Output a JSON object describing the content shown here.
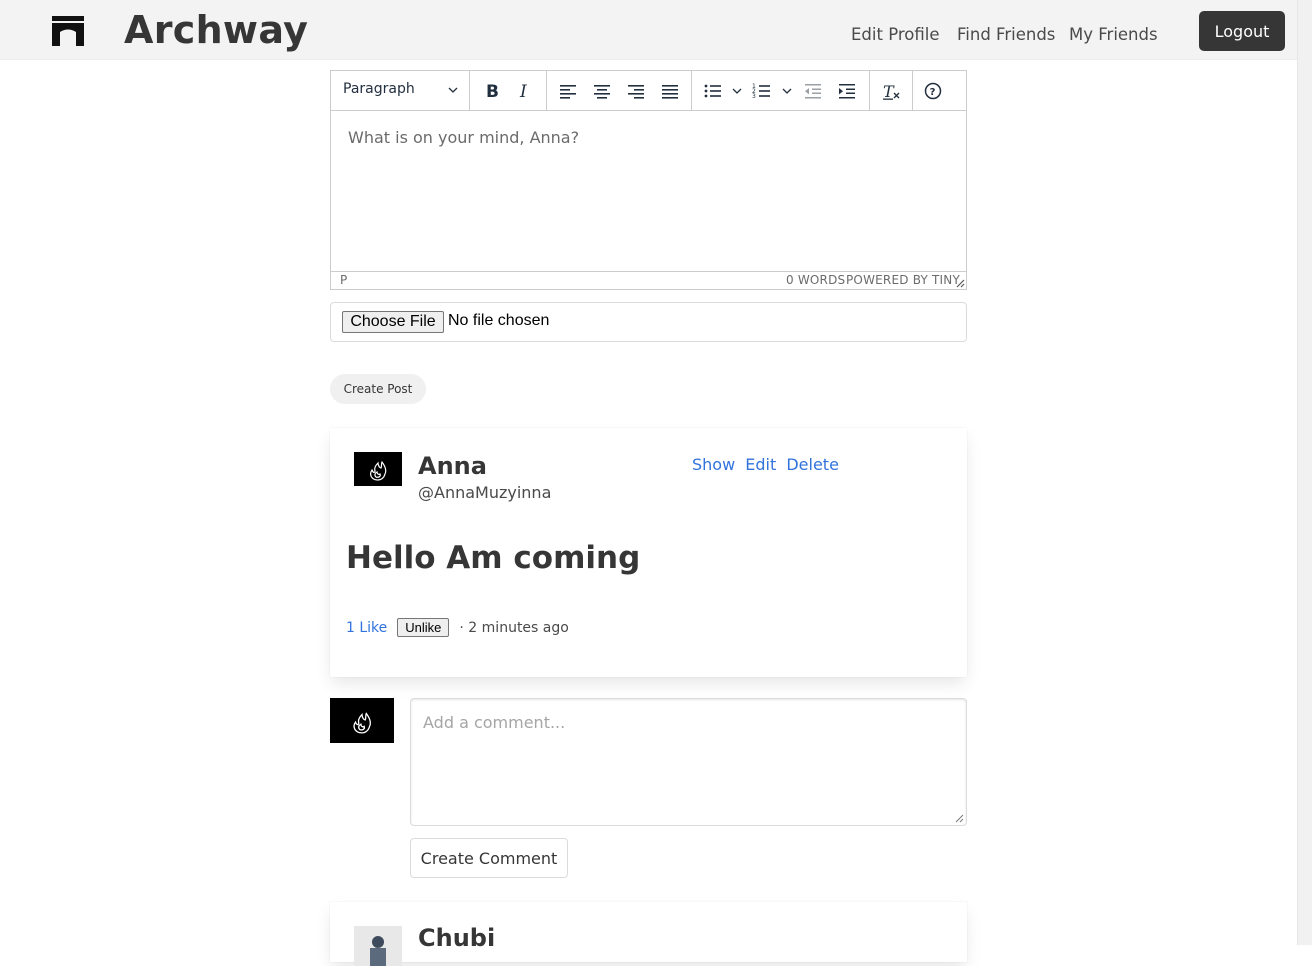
{
  "navbar": {
    "brand": "Archway",
    "links": [
      "Edit Profile",
      "Find Friends",
      "My Friends"
    ],
    "logout": "Logout"
  },
  "editor": {
    "format": "Paragraph",
    "placeholder": "What is on your mind, Anna?",
    "status_path": "P",
    "word_count": "0 WORDS",
    "powered_by": "POWERED BY TINY"
  },
  "file_input": {
    "button": "Choose File",
    "status": "No file chosen"
  },
  "create_post": "Create Post",
  "post": {
    "author_name": "Anna",
    "author_handle": "@AnnaMuzyinna",
    "actions": [
      "Show",
      "Edit",
      "Delete"
    ],
    "title": "Hello Am coming",
    "likes": "1 Like",
    "unlike": "Unlike",
    "timestamp": "· 2 minutes ago"
  },
  "comment": {
    "placeholder": "Add a comment...",
    "submit": "Create Comment"
  },
  "next_post": {
    "author_name": "Chubi"
  }
}
